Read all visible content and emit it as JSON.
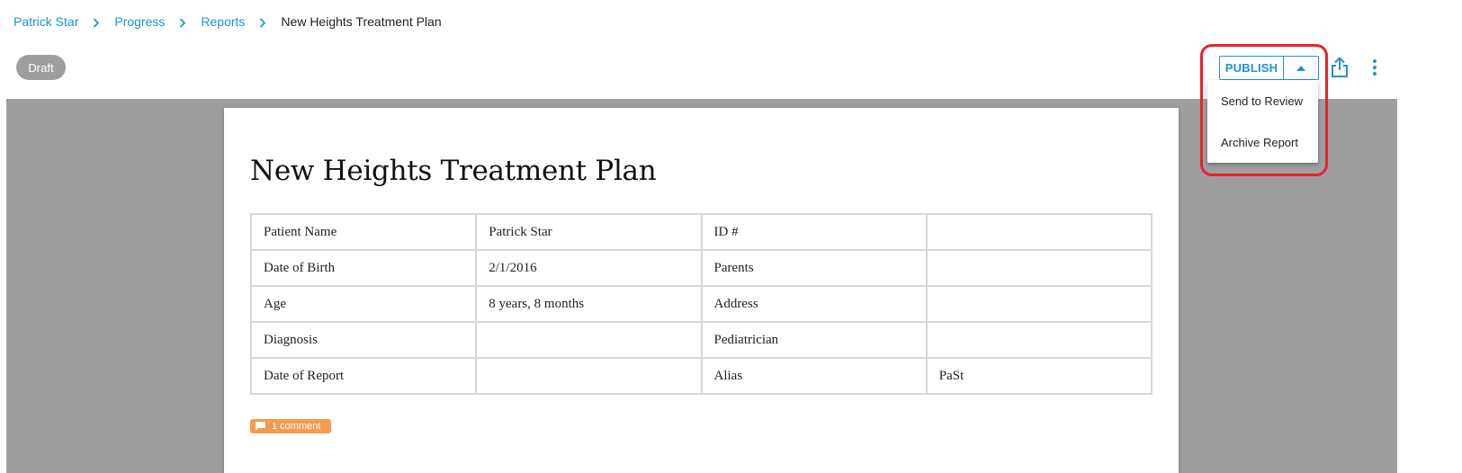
{
  "breadcrumb": {
    "items": [
      "Patrick Star",
      "Progress",
      "Reports"
    ],
    "current": "New Heights Treatment Plan"
  },
  "status_badge": "Draft",
  "toolbar": {
    "publish_label": "PUBLISH",
    "toggle_icon": "caret-up-icon",
    "share_icon": "share-icon",
    "more_icon": "more-vert-icon"
  },
  "publish_menu": {
    "items": [
      "Send to Review",
      "Archive Report"
    ]
  },
  "document": {
    "title": "New Heights Treatment Plan",
    "table": [
      [
        "Patient Name",
        "Patrick Star",
        "ID #",
        ""
      ],
      [
        "Date of Birth",
        "2/1/2016",
        "Parents",
        ""
      ],
      [
        "Age",
        "8 years, 8 months",
        "Address",
        ""
      ],
      [
        "Diagnosis",
        "",
        "Pediatrician",
        ""
      ],
      [
        "Date of Report",
        "",
        "Alias",
        "PaSt"
      ]
    ],
    "comment_tag": "1 comment"
  },
  "colors": {
    "accent": "#1f93d3",
    "badge": "#9e9e9e",
    "canvas": "#9e9e9e",
    "comment": "#f59a4e",
    "highlight": "#e8222b"
  }
}
